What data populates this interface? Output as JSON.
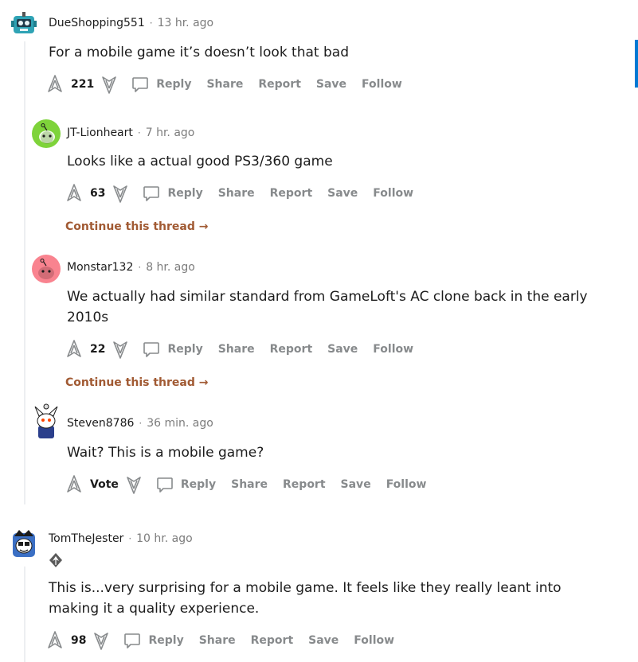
{
  "colors": {
    "accent_bar": "#0079d3",
    "continue_link": "#a15a33",
    "meta_gray": "#7c7c7c",
    "action_gray": "#878a8c"
  },
  "actions": {
    "reply": "Reply",
    "share": "Share",
    "report": "Report",
    "save": "Save",
    "follow": "Follow",
    "dot": "·"
  },
  "continue_label": "Continue this thread →",
  "comments": [
    {
      "username": "DueShopping551",
      "time": "13 hr. ago",
      "text": "For a mobile game it’s doesn’t look that bad",
      "score": "221",
      "avatar_icon": "robot-avatar-icon"
    },
    {
      "username": "JT-Lionheart",
      "time": "7 hr. ago",
      "text": "Looks like a actual good PS3/360 game",
      "score": "63",
      "avatar_icon": "snoo-green-avatar-icon"
    },
    {
      "username": "Monstar132",
      "time": "8 hr. ago",
      "text": "We actually had similar standard from GameLoft's AC clone back in the early 2010s",
      "score": "22",
      "avatar_icon": "snoo-pink-avatar-icon"
    },
    {
      "username": "Steven8786",
      "time": "36 min. ago",
      "text": "Wait? This is a mobile game?",
      "score": "Vote",
      "avatar_icon": "snoo-custom-avatar-icon"
    },
    {
      "username": "TomTheJester",
      "time": "10 hr. ago",
      "text": "This is...very surprising for a mobile game. It feels like they really leant into making it a quality experience.",
      "score": "98",
      "avatar_icon": "jester-avatar-icon",
      "flair_icon": "assassin-emblem-flair-icon"
    }
  ]
}
